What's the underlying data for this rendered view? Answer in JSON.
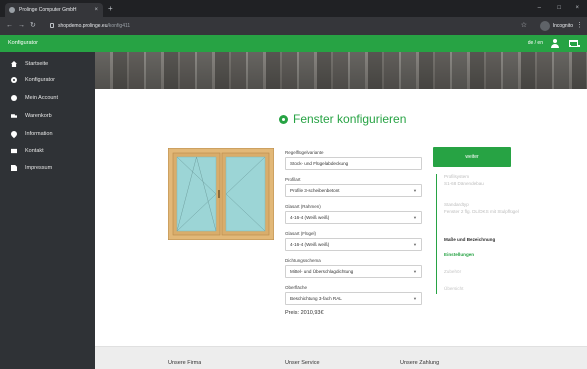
{
  "browser": {
    "tab_title": "Prolinge Computer GmbH",
    "tab_close": "×",
    "new_tab": "+",
    "url_host": "shopdemo.prolinge.eu",
    "url_path": "/konfig411",
    "profile_label": "Incognito",
    "window_controls": [
      "–",
      "□",
      "×"
    ]
  },
  "header": {
    "title": "Konfigurator",
    "lang": "de / en"
  },
  "sidebar": {
    "items": [
      {
        "label": "Startseite",
        "icon": "home-icon"
      },
      {
        "label": "Konfigurator",
        "icon": "gear-icon"
      },
      {
        "label": "Mein Account",
        "icon": "user-icon"
      },
      {
        "label": "Warenkorb",
        "icon": "truck-icon"
      },
      {
        "label": "Information",
        "icon": "map-pin-icon"
      },
      {
        "label": "Kontakt",
        "icon": "mail-icon"
      },
      {
        "label": "Impressum",
        "icon": "document-icon"
      }
    ]
  },
  "main": {
    "title": "Fenster konfigurieren",
    "fields": [
      {
        "label": "Regelflügelvariante",
        "value": "Stock- und Flügelabdeckung"
      },
      {
        "label": "Profilart",
        "value": "Profile 3-scheibenbetont"
      },
      {
        "label": "Glasart (Rahmen)",
        "value": "4-16-4 (Weiß weiß)"
      },
      {
        "label": "Glasart (Flügel)",
        "value": "4-16-4 (Weiß weiß)"
      },
      {
        "label": "Dichtungsschema",
        "value": "Mittel- und Überschlagdichtung"
      },
      {
        "label": "Oberfläche",
        "value": "Beschichtung 3-fach RAL"
      }
    ],
    "price": "Preis: 2010,93€",
    "next_button": "weiter",
    "steps": [
      {
        "title": "Profilsystem",
        "sub": "S1-68 Dänendebau",
        "state": "done"
      },
      {
        "title": "Standardtyp",
        "sub": "Fenster 2 flg. DL/DKS mit Stulpflügel",
        "state": "done"
      },
      {
        "title": "Maße und Bezeichnung",
        "sub": "",
        "state": "current"
      },
      {
        "title": "Einstellungen",
        "sub": "",
        "state": "active"
      },
      {
        "title": "Zubehör",
        "sub": "",
        "state": "todo"
      },
      {
        "title": "Übersicht",
        "sub": "",
        "state": "todo"
      }
    ]
  },
  "footer": {
    "columns": [
      "Unsere Firma",
      "Unser Service",
      "Unsere Zahlung"
    ]
  },
  "colors": {
    "accent": "#27a344",
    "sidebar_bg": "#2f3236",
    "window_frame": "#e2b878",
    "glass": "#9cd5d6"
  }
}
